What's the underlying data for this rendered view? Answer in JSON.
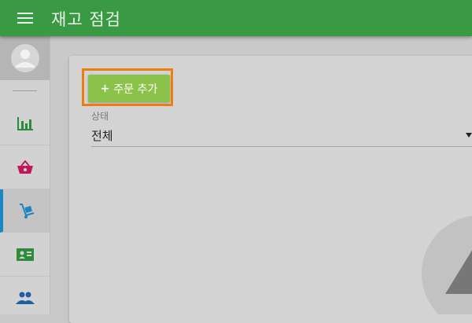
{
  "app": {
    "title": "재고 점검",
    "accent_color": "#3a9a43",
    "menu_icon": "hamburger-menu-icon"
  },
  "sidebar": {
    "avatar_icon": "user-avatar-icon",
    "items": [
      {
        "id": "reports",
        "icon": "bar-chart-icon",
        "color": "#2e8b3a",
        "active": false
      },
      {
        "id": "shop",
        "icon": "shopping-basket-icon",
        "color": "#c2185b",
        "active": false
      },
      {
        "id": "inventory",
        "icon": "hand-truck-icon",
        "color": "#1c86c4",
        "active": true
      },
      {
        "id": "contacts",
        "icon": "contact-card-icon",
        "color": "#2e8b3a",
        "active": false
      },
      {
        "id": "users",
        "icon": "people-icon",
        "color": "#1c5fa8",
        "active": false
      }
    ]
  },
  "main": {
    "add_order_button": {
      "plus": "+",
      "label": "주문 추가",
      "color": "#8bc34a",
      "highlight_color": "#ef7d12"
    },
    "status_filter": {
      "label": "상태",
      "value": "전체"
    }
  }
}
